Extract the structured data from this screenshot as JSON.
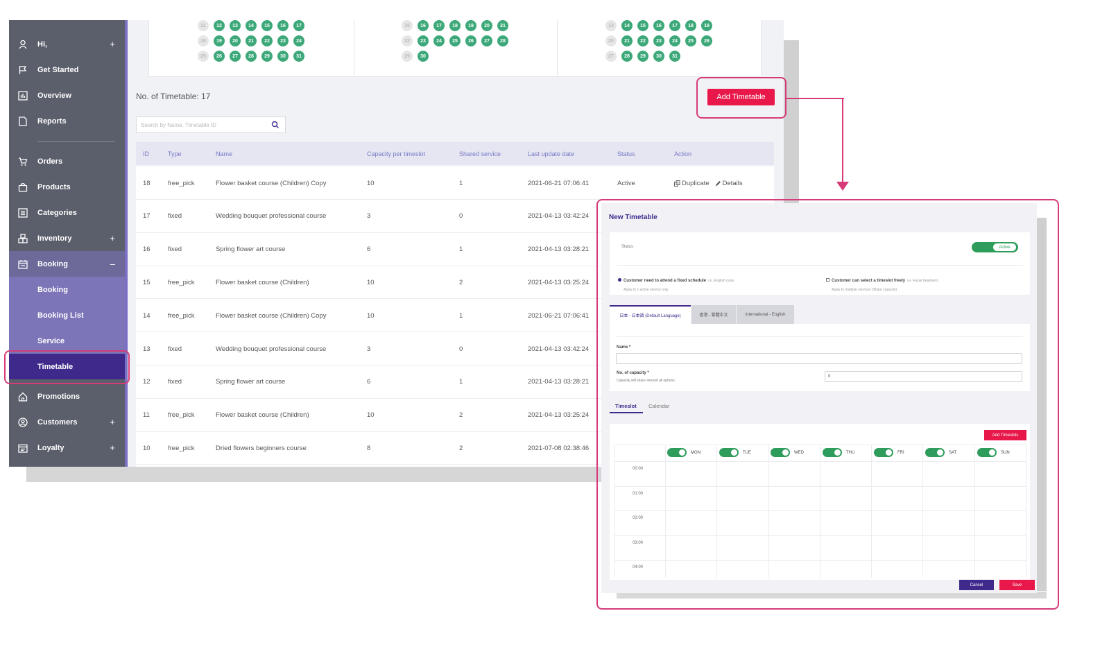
{
  "sidebar": {
    "items": [
      {
        "label": "Hi,",
        "icon": "user-icon",
        "plus": "+"
      },
      {
        "label": "Get Started",
        "icon": "flag-icon"
      },
      {
        "label": "Overview",
        "icon": "chart-icon"
      },
      {
        "label": "Reports",
        "icon": "document-icon"
      },
      {
        "label": "Orders",
        "icon": "cart-icon"
      },
      {
        "label": "Products",
        "icon": "bag-icon"
      },
      {
        "label": "Categories",
        "icon": "list-icon"
      },
      {
        "label": "Inventory",
        "icon": "boxes-icon",
        "plus": "+"
      },
      {
        "label": "Booking",
        "icon": "calendar-icon",
        "plus": "–"
      },
      {
        "label": "Promotions",
        "icon": "home-icon"
      },
      {
        "label": "Customers",
        "icon": "person-circle-icon",
        "plus": "+"
      },
      {
        "label": "Loyalty",
        "icon": "loyalty-icon",
        "plus": "+"
      }
    ],
    "booking_sub": [
      "Booking",
      "Booking List",
      "Service",
      "Timetable"
    ],
    "active": "Timetable"
  },
  "calendar": {
    "months": [
      {
        "faded": [
          "11",
          "18",
          "25"
        ],
        "rows": [
          [
            "12",
            "13",
            "14",
            "15",
            "16",
            "17"
          ],
          [
            "19",
            "20",
            "21",
            "22",
            "23",
            "24"
          ],
          [
            "26",
            "27",
            "28",
            "29",
            "30",
            "31"
          ]
        ]
      },
      {
        "faded": [
          "15",
          "22",
          "29"
        ],
        "rows": [
          [
            "16",
            "17",
            "18",
            "19",
            "20",
            "21"
          ],
          [
            "23",
            "24",
            "25",
            "26",
            "27",
            "28"
          ],
          [
            "30"
          ]
        ]
      },
      {
        "faded": [
          "13",
          "20",
          "27"
        ],
        "rows": [
          [
            "14",
            "15",
            "16",
            "17",
            "18",
            "19"
          ],
          [
            "21",
            "22",
            "23",
            "24",
            "25",
            "26"
          ],
          [
            "28",
            "29",
            "30",
            "31"
          ]
        ]
      }
    ]
  },
  "page": {
    "count_label": "No. of Timetable: 17",
    "add_button": "Add Timetable",
    "search_placeholder": "Search by Name, Timetable ID"
  },
  "table": {
    "headers": [
      "ID",
      "Type",
      "Name",
      "Capacity per timeslot",
      "Shared service",
      "Last update date",
      "Status",
      "Action"
    ],
    "actions": {
      "duplicate": "Duplicate",
      "details": "Details"
    },
    "rows": [
      {
        "id": "18",
        "type": "free_pick",
        "name": "Flower basket course (Children) Copy",
        "capacity": "10",
        "shared": "1",
        "date": "2021-06-21 07:06:41",
        "status": "Active"
      },
      {
        "id": "17",
        "type": "fixed",
        "name": "Wedding bouquet professional course",
        "capacity": "3",
        "shared": "0",
        "date": "2021-04-13 03:42:24",
        "status": ""
      },
      {
        "id": "16",
        "type": "fixed",
        "name": "Spring flower art course",
        "capacity": "6",
        "shared": "1",
        "date": "2021-04-13 03:28:21",
        "status": ""
      },
      {
        "id": "15",
        "type": "free_pick",
        "name": "Flower basket course (Children)",
        "capacity": "10",
        "shared": "2",
        "date": "2021-04-13 03:25:24",
        "status": ""
      },
      {
        "id": "14",
        "type": "free_pick",
        "name": "Flower basket course (Children) Copy",
        "capacity": "10",
        "shared": "1",
        "date": "2021-06-21 07:06:41",
        "status": ""
      },
      {
        "id": "13",
        "type": "fixed",
        "name": "Wedding bouquet professional course",
        "capacity": "3",
        "shared": "0",
        "date": "2021-04-13 03:42:24",
        "status": ""
      },
      {
        "id": "12",
        "type": "fixed",
        "name": "Spring flower art course",
        "capacity": "6",
        "shared": "1",
        "date": "2021-04-13 03:28:21",
        "status": ""
      },
      {
        "id": "11",
        "type": "free_pick",
        "name": "Flower basket course (Children)",
        "capacity": "10",
        "shared": "2",
        "date": "2021-04-13 03:25:24",
        "status": ""
      },
      {
        "id": "10",
        "type": "free_pick",
        "name": "Dried flowers beginners course",
        "capacity": "8",
        "shared": "2",
        "date": "2021-07-08 02:38:46",
        "status": ""
      }
    ]
  },
  "modal": {
    "title": "New Timetable",
    "status_label": "Status",
    "status_toggle": "Active",
    "option_fixed": {
      "title": "Customer need to attend a fixed schedule",
      "hint": "i.e. English class",
      "sub": "Apply to 1 active service only"
    },
    "option_free": {
      "title": "Customer can select a timeslot freely",
      "hint": "i.e. Facial treatment",
      "sub": "Apply to multiple services (Share capacity)"
    },
    "lang_tabs": [
      "日本 - 日本語 (Default Language)",
      "香港 - 繁體中文",
      "International - English"
    ],
    "name_label": "Name *",
    "capacity_label": "No. of capacity *",
    "capacity_hint": "Capacity will share amount all options.",
    "capacity_value": "0",
    "sub_tabs": [
      "Timeslot",
      "Calendar"
    ],
    "add_timeslots": "Add Timeslots",
    "days": [
      "MON",
      "TUE",
      "WED",
      "THU",
      "FRI",
      "SAT",
      "SUN"
    ],
    "times": [
      "00:00",
      "01:00",
      "02:00",
      "03:00",
      "04:00"
    ],
    "cancel": "Cancel",
    "save": "Save"
  },
  "colors": {
    "accent": "#3f2a8c",
    "brand_red": "#e8194a",
    "green": "#3da97a",
    "highlight": "#d63a78",
    "sidebar": "#5b5f6b"
  }
}
